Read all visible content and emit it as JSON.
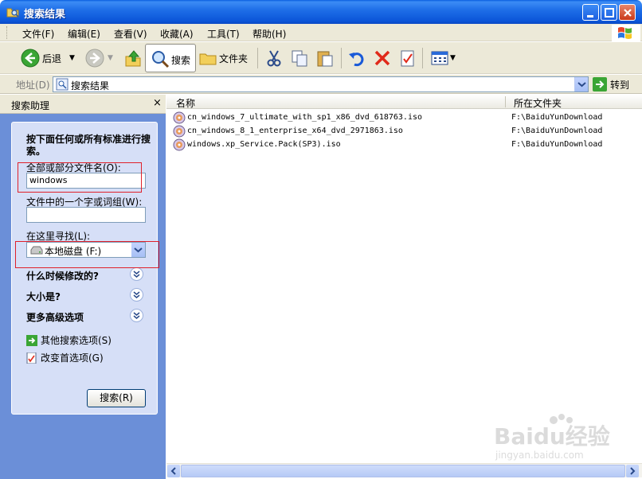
{
  "window": {
    "title": "搜索结果"
  },
  "menu": [
    "文件(F)",
    "编辑(E)",
    "查看(V)",
    "收藏(A)",
    "工具(T)",
    "帮助(H)"
  ],
  "toolbar": {
    "back": "后退",
    "search": "搜索",
    "folders": "文件夹"
  },
  "address": {
    "label": "地址(D)",
    "value": "搜索结果",
    "go": "转到"
  },
  "left_pane": {
    "title": "搜索助理",
    "close": "×",
    "instruction": "按下面任何或所有标准进行搜索。",
    "name_label": "全部或部分文件名(O):",
    "name_value": "windows",
    "word_label": "文件中的一个字或词组(W):",
    "word_value": "",
    "look_in_label": "在这里寻找(L):",
    "look_in_value": "本地磁盘 (F:)",
    "when_modified": "什么时候修改的?",
    "size": "大小是?",
    "advanced": "更多高级选项",
    "other_options": "其他搜索选项(S)",
    "preferences": "改变首选项(G)",
    "search_button": "搜索(R)"
  },
  "results": {
    "columns": [
      "名称",
      "所在文件夹"
    ],
    "rows": [
      {
        "name": "cn_windows_7_ultimate_with_sp1_x86_dvd_618763.iso",
        "folder": "F:\\BaiduYunDownload"
      },
      {
        "name": "cn_windows_8_1_enterprise_x64_dvd_2971863.iso",
        "folder": "F:\\BaiduYunDownload"
      },
      {
        "name": "windows.xp_Service.Pack(SP3).iso",
        "folder": "F:\\BaiduYunDownload"
      }
    ]
  },
  "colors": {
    "title_blue": "#0b55d8",
    "pane_blue": "#6b8fd8",
    "panel_bg": "#d6dff7",
    "highlight_red": "#e0202a"
  },
  "watermark": "Baidu经验 jingyan.baidu.com"
}
